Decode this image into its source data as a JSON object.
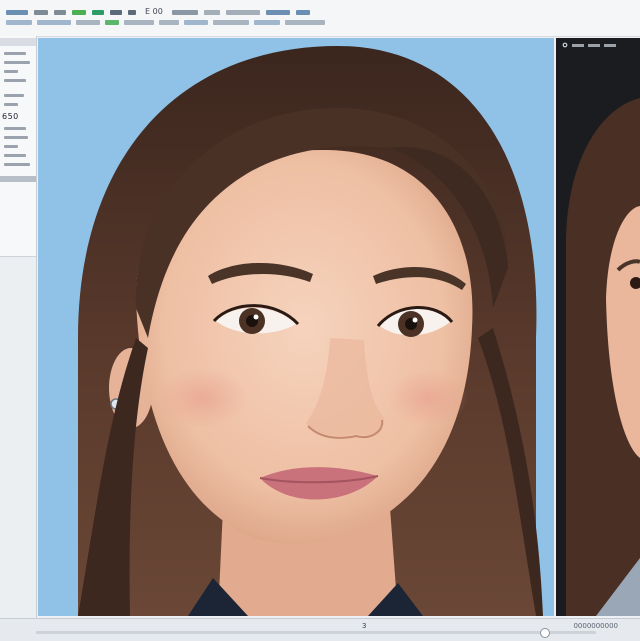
{
  "toolbar": {
    "label": "E 00",
    "chip_colors": [
      "#6b8fb3",
      "#7e8a96",
      "#4caf50",
      "#2e9c68",
      "#5c6b7a",
      "#8a97a5"
    ]
  },
  "sidebar": {
    "value": "650"
  },
  "status": {
    "page": "3",
    "zoom": "0000000000"
  },
  "colors": {
    "canvas_bg": "#8fc2e6",
    "second_canvas_bg": "#1b1c1f",
    "hair": "#4a3126"
  },
  "icons": [
    "gear-icon",
    "image-icon"
  ]
}
